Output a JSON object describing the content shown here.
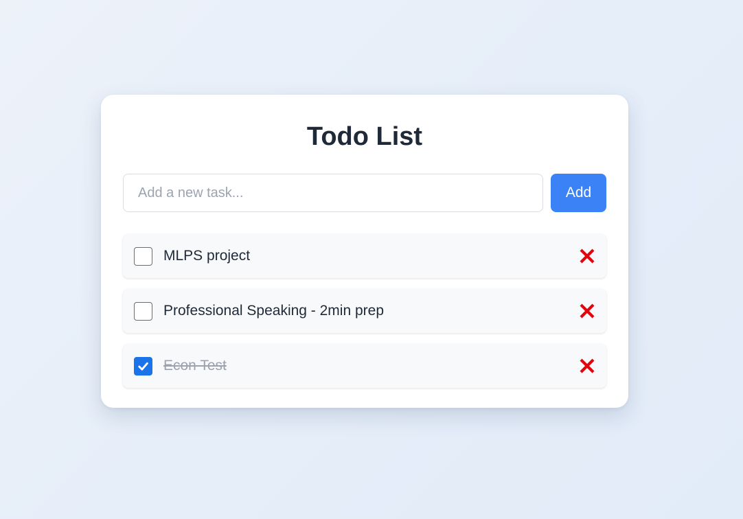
{
  "app": {
    "title": "Todo List"
  },
  "new_task": {
    "placeholder": "Add a new task...",
    "value": "",
    "add_label": "Add"
  },
  "todos": [
    {
      "text": "MLPS project",
      "completed": false
    },
    {
      "text": "Professional Speaking - 2min prep",
      "completed": false
    },
    {
      "text": "Econ Test",
      "completed": true
    }
  ],
  "colors": {
    "accent": "#3b82f6",
    "checkbox_checked": "#1a73e8",
    "delete": "#e0060f",
    "title": "#1f2937",
    "completed_text": "#9ca3af"
  },
  "icons": {
    "delete": "x-mark-icon",
    "check": "check-icon"
  }
}
